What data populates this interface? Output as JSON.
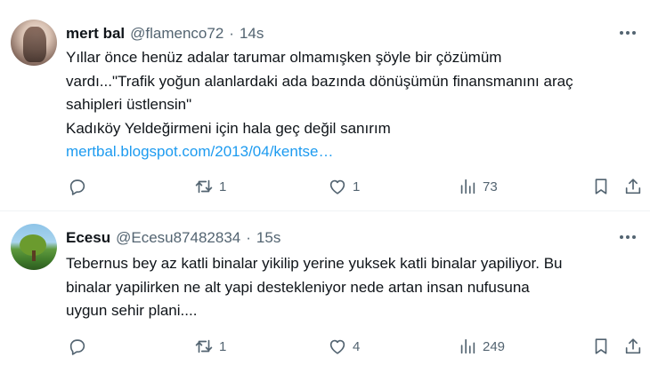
{
  "tweets": [
    {
      "author_name": "mert bal",
      "handle": "@flamenco72",
      "separator": "·",
      "time": "14s",
      "text_lines": [
        "Yıllar önce henüz adalar tarumar olmamışken şöyle bir çözümüm",
        "vardı...\"Trafik yoğun alanlardaki ada bazında dönüşümün finansmanını araç",
        "sahipleri üstlensin\"",
        "Kadıköy Yeldeğirmeni için hala geç değil sanırım"
      ],
      "link": "mertbal.blogspot.com/2013/04/kentse…",
      "replies": "",
      "retweets": "1",
      "likes": "1",
      "views": "73"
    },
    {
      "author_name": "Ecesu",
      "handle": "@Ecesu87482834",
      "separator": "·",
      "time": "15s",
      "text_lines": [
        "Tebernus bey az katli binalar yikilip yerine yuksek katli binalar yapiliyor. Bu",
        "binalar yapilirken ne alt yapi destekleniyor nede artan insan nufusuna",
        "uygun sehir plani...."
      ],
      "link": "",
      "replies": "",
      "retweets": "1",
      "likes": "4",
      "views": "249"
    }
  ],
  "icons": [
    "more-icon",
    "reply-icon",
    "retweet-icon",
    "like-icon",
    "views-icon",
    "bookmark-icon",
    "share-icon"
  ],
  "colors": {
    "text": "#0f1419",
    "secondary": "#536471",
    "link": "#1d9bf0",
    "divider": "#eff3f4"
  }
}
